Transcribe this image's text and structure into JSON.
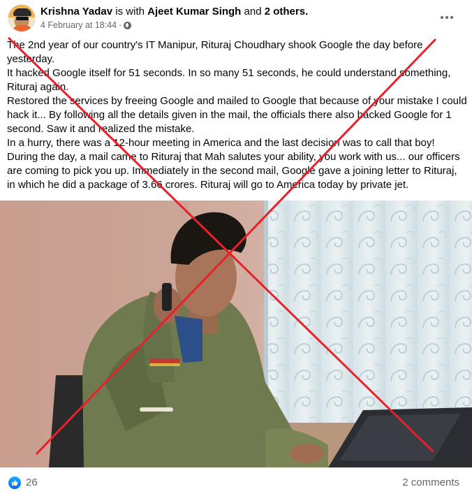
{
  "post": {
    "author": "Krishna Yadav",
    "with_word": "is with",
    "tagged_person": "Ajeet Kumar Singh",
    "and_word": "and",
    "others": "2 others.",
    "timestamp": "4 February at 18:44",
    "separator": "·",
    "audience_icon": "globe-icon",
    "more_icon": "more-options-icon",
    "text_lines": [
      "The 2nd year of our country's IT Manipur, Rituraj Choudhary shook Google the day before yesterday.",
      "It hacked Google itself for 51 seconds. In so many 51 seconds, he could understand something, Rituraj again.",
      "Restored the services by freeing Google and mailed to Google that because of your mistake I could hack it... By following all the details given in the mail, the officials there also hacked Google for 1 second. Saw it and realized the mistake.",
      "In a hurry, there was a 12-hour meeting in America and the last decision was to call that boy! During the day, a mail came to Rituraj that Mah salutes your ability, you work with us... our officers are coming to pick you up. Immediately in the second mail, Google gave a joining letter to Rituraj, in which he did a package of 3.66 crores. Rituraj will go to America today by private jet."
    ]
  },
  "photo": {
    "subject": "young man on phone at laptop",
    "overlay": "red-cross-mark"
  },
  "footer": {
    "reaction_icon": "like-icon",
    "reaction_count": "26",
    "comments": "2 comments"
  },
  "colors": {
    "cross": "#e8202a",
    "meta_gray": "#65676b",
    "like_blue": "#0866ff"
  }
}
